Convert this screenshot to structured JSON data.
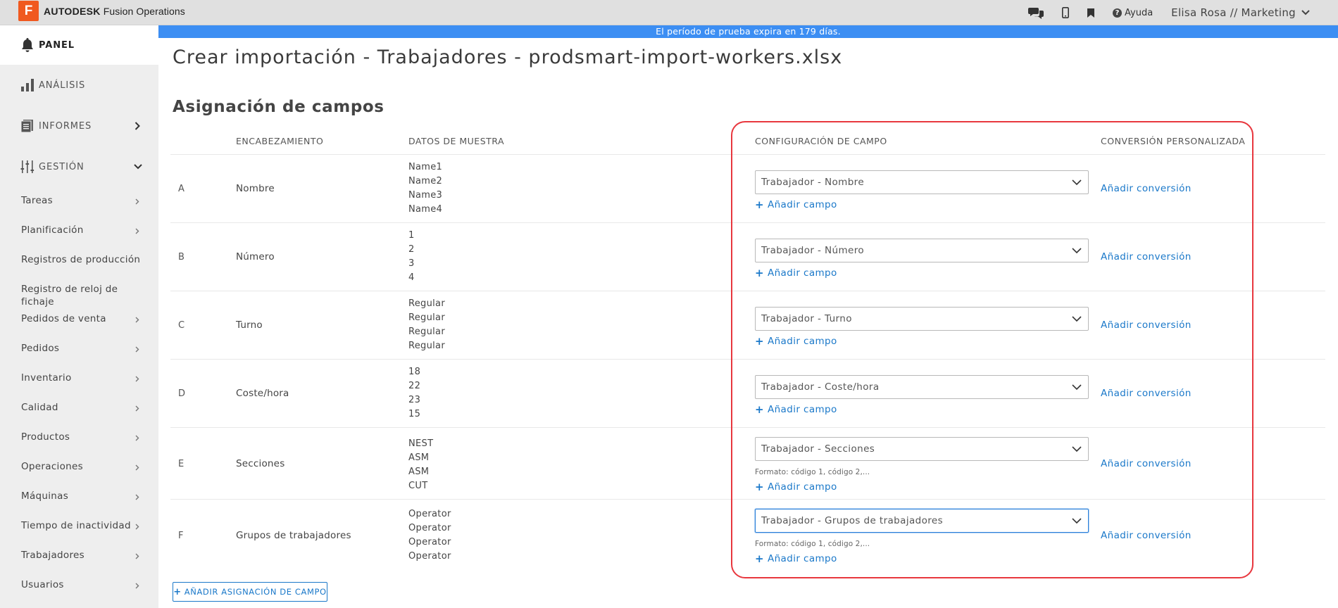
{
  "app": {
    "logo_letter": "F",
    "brand": "AUTODESK",
    "product": "Fusion Operations"
  },
  "topbar": {
    "help_label": "Ayuda",
    "user_label": "Elisa Rosa // Marketing"
  },
  "trial_banner": "El período de prueba expira en 179 días.",
  "sidebar": {
    "panel": "PANEL",
    "analysis": "ANÁLISIS",
    "reports": "INFORMES",
    "management": "GESTIÓN",
    "items": [
      "Tareas",
      "Planificación",
      "Registros de producción",
      "Registro de reloj de fichaje",
      "Pedidos de venta",
      "Pedidos",
      "Inventario",
      "Calidad",
      "Productos",
      "Operaciones",
      "Máquinas",
      "Tiempo de inactividad",
      "Trabajadores",
      "Usuarios"
    ]
  },
  "main": {
    "title": "Crear importación - Trabajadores - prodsmart-import-workers.xlsx",
    "section_title": "Asignación de campos",
    "columns": {
      "header": "ENCABEZAMIENTO",
      "sample": "DATOS DE MUESTRA",
      "field_config": "CONFIGURACIÓN DE CAMPO",
      "custom_conversion": "CONVERSIÓN PERSONALIZADA"
    },
    "add_field_label": "Añadir campo",
    "add_conversion_label": "Añadir conversión",
    "rows": [
      {
        "letter": "A",
        "header": "Nombre",
        "samples": [
          "Name1",
          "Name2",
          "Name3",
          "Name4"
        ],
        "field": "Trabajador - Nombre",
        "hint": ""
      },
      {
        "letter": "B",
        "header": "Número",
        "samples": [
          "1",
          "2",
          "3",
          "4"
        ],
        "field": "Trabajador - Número",
        "hint": ""
      },
      {
        "letter": "C",
        "header": "Turno",
        "samples": [
          "Regular",
          "Regular",
          "Regular",
          "Regular"
        ],
        "field": "Trabajador - Turno",
        "hint": ""
      },
      {
        "letter": "D",
        "header": "Coste/hora",
        "samples": [
          "18",
          "22",
          "23",
          "15"
        ],
        "field": "Trabajador - Coste/hora",
        "hint": ""
      },
      {
        "letter": "E",
        "header": "Secciones",
        "samples": [
          "NEST",
          "ASM",
          "ASM",
          "CUT"
        ],
        "field": "Trabajador - Secciones",
        "hint": "Formato: código 1, código 2,..."
      },
      {
        "letter": "F",
        "header": "Grupos de trabajadores",
        "samples": [
          "Operator",
          "Operator",
          "Operator",
          "Operator"
        ],
        "field": "Trabajador - Grupos de trabajadores",
        "hint": "Formato: código 1, código 2,..."
      }
    ],
    "add_mapping_label": "AÑADIR ASIGNACIÓN DE CAMPO"
  },
  "colors": {
    "accent": "#1a78c9",
    "banner": "#3c8ef3",
    "highlight": "#e8373e",
    "logo": "#f0591f"
  }
}
